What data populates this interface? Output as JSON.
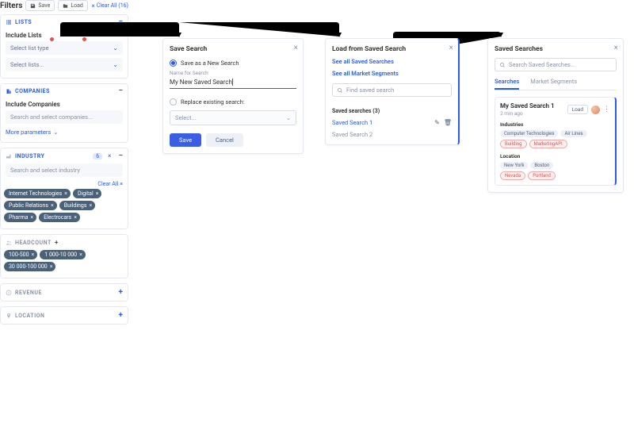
{
  "filters": {
    "title": "Filters",
    "save_label": "Save",
    "load_label": "Load",
    "clear_all_label": "Clear All (16)",
    "lists": {
      "head": "LISTS",
      "include_label": "Include Lists",
      "select_type_placeholder": "Select list type",
      "select_lists_placeholder": "Select lists..."
    },
    "companies": {
      "head": "COMPANIES",
      "include_label": "Include Companies",
      "search_placeholder": "Search and select companies...",
      "more_label": "More parameters"
    },
    "industry": {
      "head": "INDUSTRY",
      "count": "6",
      "search_placeholder": "Search and select industry",
      "clear_all": "Clear All",
      "chips": [
        "Internet Technologies",
        "Digital",
        "Public Relations",
        "Buildings",
        "Pharma",
        "Electrocars"
      ]
    },
    "headcount": {
      "head": "HEADCOUNT",
      "chips": [
        "100-500",
        "1 000-10 000",
        "30 000-100 000"
      ]
    },
    "revenue": {
      "head": "REVENUE"
    },
    "location": {
      "head": "LOCATION"
    }
  },
  "save_panel": {
    "title": "Save Search",
    "option_new": "Save as a New Search",
    "name_label": "Name for Search",
    "name_value": "My New Saved Search",
    "option_replace": "Replace existing search:",
    "replace_placeholder": "Select...",
    "save_btn": "Save",
    "cancel_btn": "Cancel"
  },
  "load_panel": {
    "title": "Load from Saved Search",
    "link_all_saved": "See all Saved Searches",
    "link_all_segments": "See all Market Segments",
    "find_placeholder": "Find saved search",
    "group_label": "Saved searches (3)",
    "items": [
      {
        "name": "Saved Search 1",
        "editable": true
      },
      {
        "name": "Saved Search 2",
        "editable": false
      }
    ]
  },
  "ss_panel": {
    "title": "Saved Searches",
    "search_placeholder": "Search Saved Searches...",
    "tabs": {
      "searches": "Searches",
      "segments": "Market Segments"
    },
    "card": {
      "title": "My Saved Search 1",
      "subtitle": "2 min ago",
      "load_btn": "Load",
      "industries_label": "Industries",
      "industries_grey": [
        "Computer Technologies",
        "Air Lines"
      ],
      "industries_red": [
        "Building",
        "MarketingAPI"
      ],
      "location_label": "Location",
      "location_grey": [
        "New York",
        "Boston"
      ],
      "location_red": [
        "Nevada",
        "Portland"
      ]
    }
  }
}
